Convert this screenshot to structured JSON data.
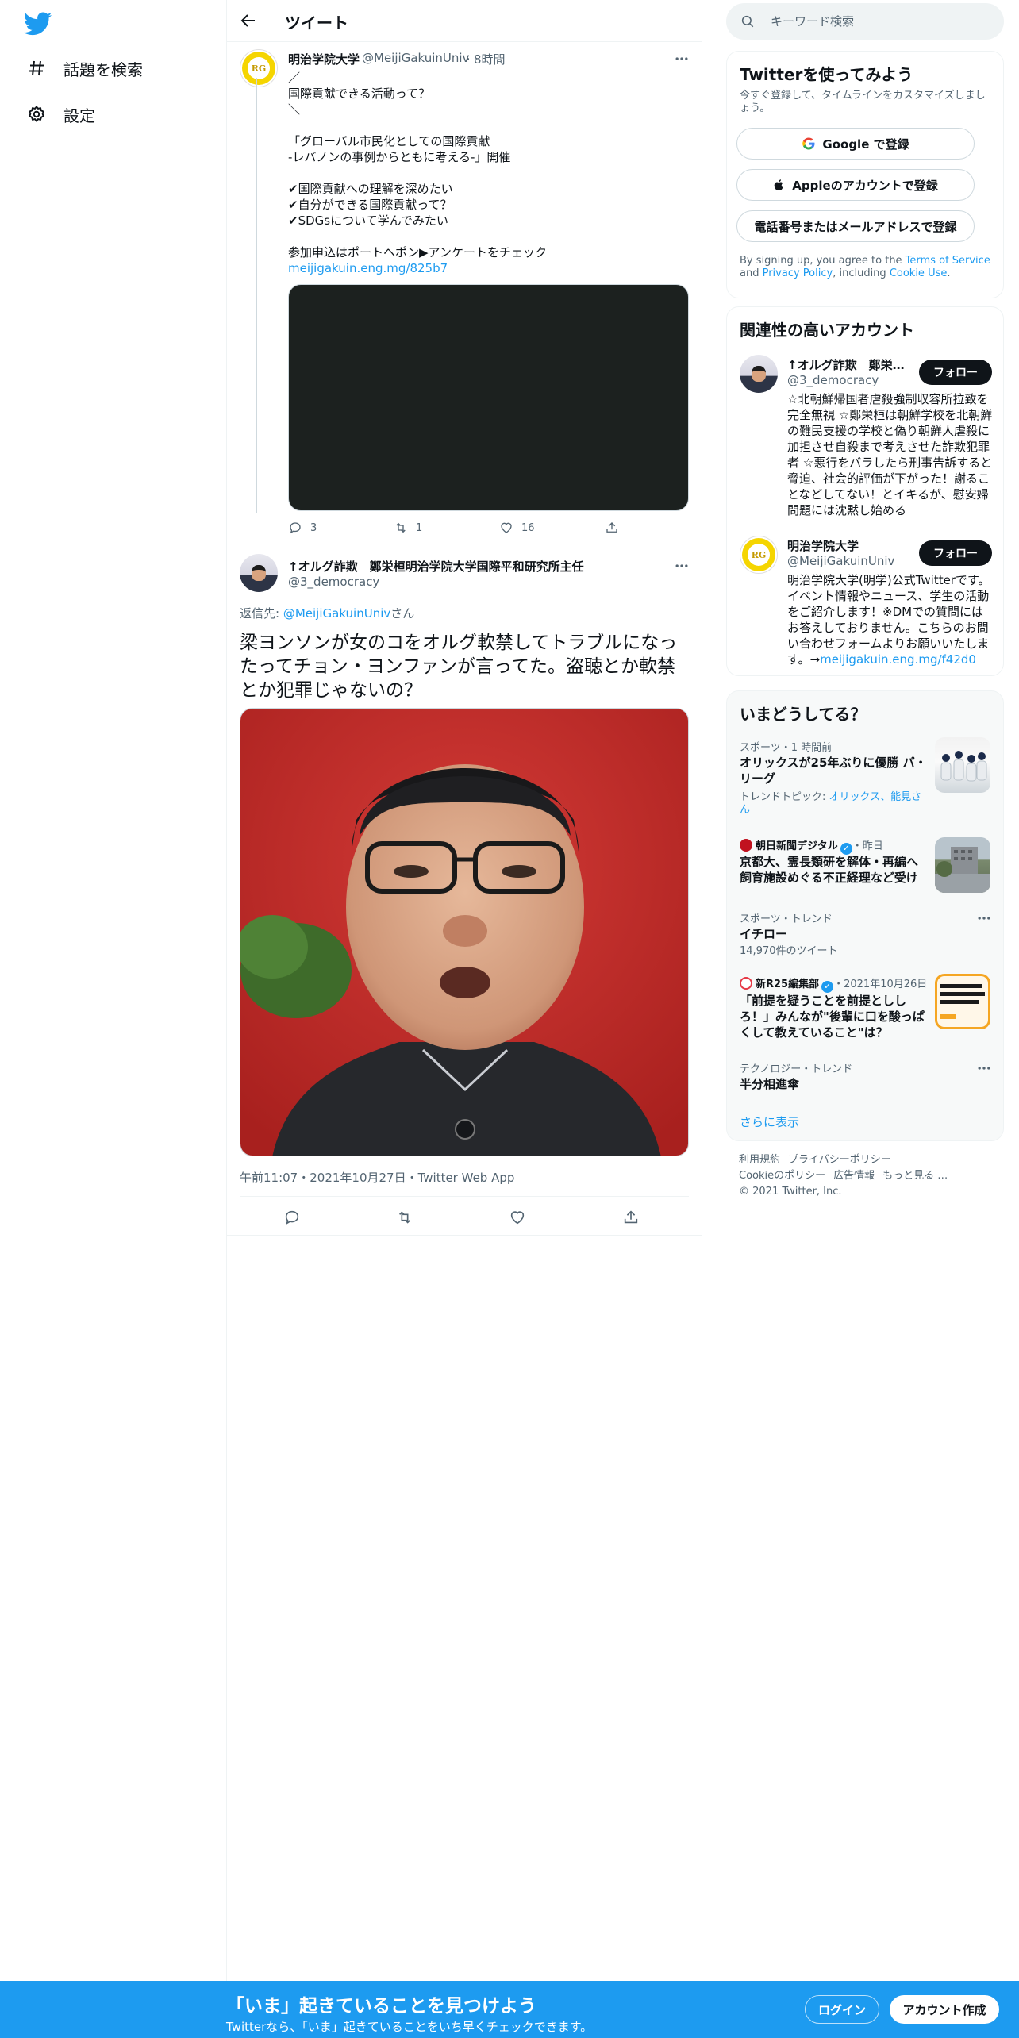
{
  "nav": {
    "explore_label": "話題を検索",
    "settings_label": "設定"
  },
  "header": {
    "title": "ツイート"
  },
  "tweet1": {
    "name": "明治学院大学",
    "handle": "@MeijiGakuinUniv",
    "time": "8時間",
    "body": "／\n国際貢献できる活動って？\n＼\n\n「グローバル市民化としての国際貢献\n-レバノンの事例からともに考える-」開催\n\n✔国際貢献への理解を深めたい\n✔自分ができる国際貢献って？\n✔SDGsについて学んでみたい\n\n参加申込はポートヘポン▶アンケートをチェック",
    "link": "meijigakuin.eng.mg/825b7",
    "reply_count": "3",
    "retweet_count": "1",
    "like_count": "16"
  },
  "tweet2": {
    "name": "↑オルグ詐欺　鄭栄桓明治学院大学国際平和研究所主任",
    "handle": "@3_democracy",
    "reply_prefix": "返信先: ",
    "reply_to": "@MeijiGakuinUniv",
    "reply_suffix": "さん",
    "body": "梁ヨンソンが女のコをオルグ軟禁してトラブルになったってチョン・ヨンファンが言ってた。盗聴とか軟禁とか犯罪じゃないの？",
    "meta": "午前11:07・2021年10月27日・Twitter Web App"
  },
  "search": {
    "placeholder": "キーワード検索"
  },
  "signup_panel": {
    "title": "Twitterを使ってみよう",
    "subtitle": "今すぐ登録して、タイムラインをカスタマイズしましょう。",
    "google_label": "Google で登録",
    "apple_label": "Appleのアカウントで登録",
    "phone_label": "電話番号またはメールアドレスで登録",
    "terms_prefix": "By signing up, you agree to the ",
    "terms_link": "Terms of Service",
    "terms_and": " and ",
    "privacy_link": "Privacy Policy",
    "terms_including": ", including ",
    "cookie_link": "Cookie Use",
    "terms_end": "."
  },
  "relevant": {
    "title": "関連性の高いアカウント",
    "follow_label": "フォロー",
    "accounts": [
      {
        "name": "↑オルグ詐欺　鄭栄桓明治学院大学国際平和研究所主任",
        "handle": "@3_democracy",
        "bio": "☆北朝鮮帰国者虐殺強制収容所拉致を完全無視 ☆鄭栄桓は朝鮮学校を北朝鮮の難民支援の学校と偽り朝鮮人虐殺に加担させ自殺まで考えさせた詐欺犯罪者 ☆悪行をバラしたら刑事告訴すると脅迫、社会的評価が下がった！謝ることなどしてない！とイキるが、慰安婦問題には沈黙し始める"
      },
      {
        "name": "明治学院大学",
        "handle": "@MeijiGakuinUniv",
        "bio": "明治学院大学(明学)公式Twitterです。イベント情報やニュース、学生の活動をご紹介します！※DMでの質問にはお答えしておりません。こちらのお問い合わせフォームよりお願いいたします。→",
        "bio_link": "meijigakuin.eng.mg/f42d0"
      }
    ]
  },
  "trends": {
    "title": "いまどうしてる？",
    "items": [
      {
        "meta": "スポーツ・1 時間前",
        "title": "オリックスが25年ぶりに優勝 パ・リーグ",
        "sub_prefix": "トレンドトピック: ",
        "sub_links": "オリックス、能見さん"
      },
      {
        "source": "朝日新聞デジタル",
        "time": "・昨日",
        "title": "京都大、霊長類研を解体・再編へ　飼育施設めぐる不正経理など受け"
      },
      {
        "meta": "スポーツ・トレンド",
        "title": "イチロー",
        "count": "14,970件のツイート"
      },
      {
        "source": "新R25編集部",
        "time": "・2021年10月26日",
        "title": "「前提を疑うことを前提とししろ！」みんなが\"後輩に口を酸っぱくして教えていること\"は？"
      },
      {
        "meta": "テクノロジー・トレンド",
        "title": "半分相進傘"
      }
    ],
    "show_more": "さらに表示"
  },
  "footer": {
    "links": [
      "利用規約",
      "プライバシーポリシー",
      "Cookieのポリシー",
      "広告情報",
      "もっと見る …"
    ],
    "copyright": "© 2021 Twitter, Inc."
  },
  "bottom_bar": {
    "title": "「いま」起きていることを見つけよう",
    "subtitle": "Twitterなら、「いま」起きていることをいち早くチェックできます。",
    "login_label": "ログイン",
    "signup_label": "アカウント作成"
  },
  "colors": {
    "accent": "#1d9bf0",
    "text": "#0f1419",
    "muted": "#536471"
  }
}
